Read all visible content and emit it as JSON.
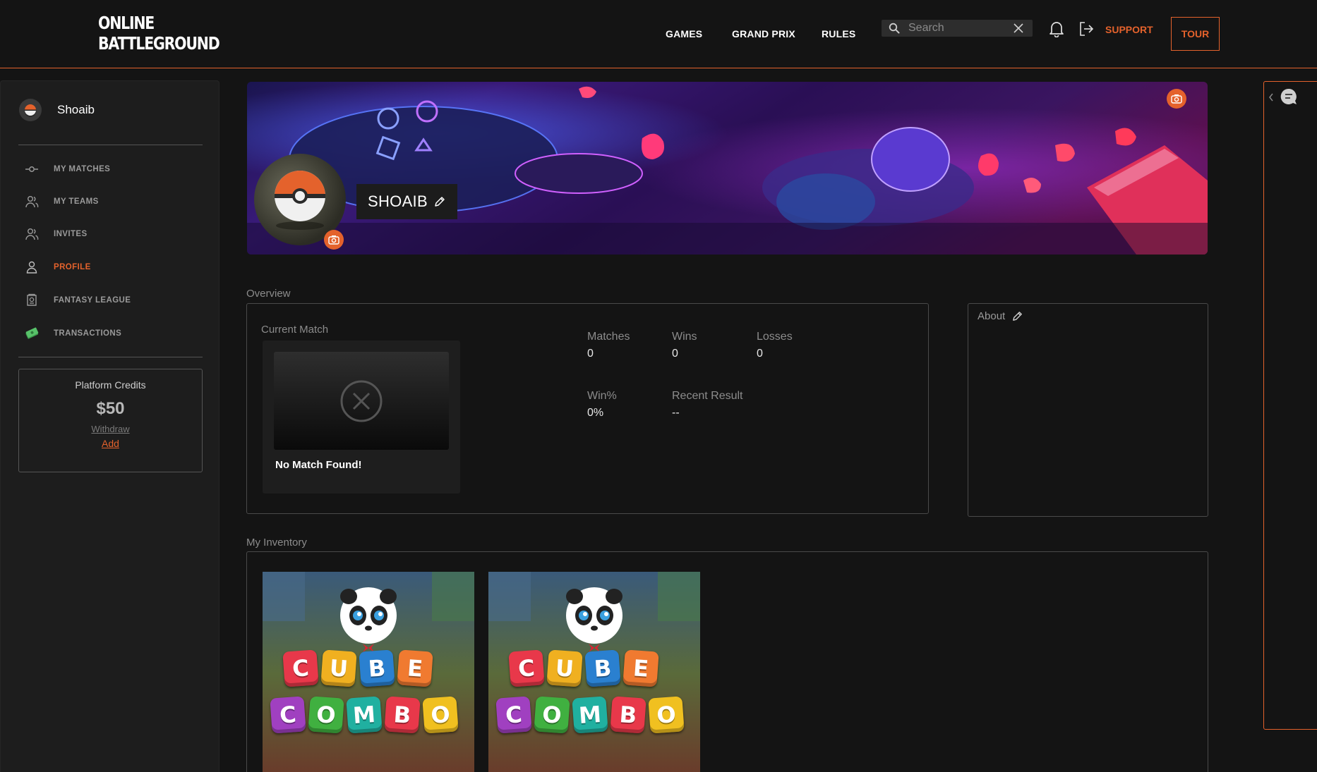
{
  "header": {
    "logo_line1": "ONLINE",
    "logo_line2": "BATTLEGROUND",
    "nav": [
      "GAMES",
      "GRAND PRIX",
      "RULES"
    ],
    "search_placeholder": "Search",
    "support_label": "SUPPORT",
    "tour_label": "TOUR"
  },
  "sidebar": {
    "username": "Shoaib",
    "items": [
      {
        "label": "MY MATCHES",
        "icon": "matches-icon"
      },
      {
        "label": "MY TEAMS",
        "icon": "teams-icon"
      },
      {
        "label": "INVITES",
        "icon": "invites-icon"
      },
      {
        "label": "PROFILE",
        "icon": "profile-icon",
        "active": true
      },
      {
        "label": "FANTASY LEAGUE",
        "icon": "fantasy-league-icon"
      },
      {
        "label": "TRANSACTIONS",
        "icon": "money-icon"
      }
    ],
    "credits": {
      "title": "Platform Credits",
      "amount": "$50",
      "withdraw_label": "Withdraw",
      "add_label": "Add"
    }
  },
  "profile": {
    "display_name": "SHOAIB"
  },
  "overview": {
    "section_label": "Overview",
    "current_match_label": "Current Match",
    "no_match_text": "No Match Found!",
    "stats": {
      "matches_label": "Matches",
      "matches_value": "0",
      "wins_label": "Wins",
      "wins_value": "0",
      "losses_label": "Losses",
      "losses_value": "0",
      "winpct_label": "Win%",
      "winpct_value": "0%",
      "recent_label": "Recent Result",
      "recent_value": "--"
    }
  },
  "about": {
    "label": "About"
  },
  "inventory": {
    "section_label": "My Inventory",
    "items": [
      {
        "line1": [
          "C",
          "U",
          "B",
          "E"
        ],
        "line2": [
          "C",
          "O",
          "M",
          "B",
          "O"
        ]
      },
      {
        "line1": [
          "C",
          "U",
          "B",
          "E"
        ],
        "line2": [
          "C",
          "O",
          "M",
          "B",
          "O"
        ]
      }
    ]
  },
  "colors": {
    "accent": "#e4622c",
    "background": "#141414",
    "panel": "#1d1d1d"
  }
}
